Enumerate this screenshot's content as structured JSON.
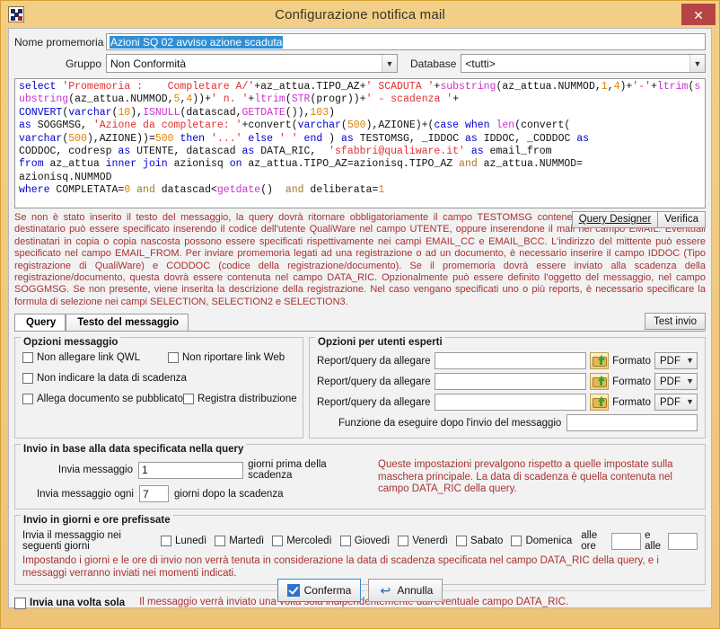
{
  "window": {
    "title": "Configurazione notifica mail",
    "close_label": "✕",
    "icon": "checkerboard-icon",
    "accent": "#eec378",
    "close_color": "#b54545"
  },
  "form": {
    "nome_label": "Nome promemoria",
    "nome_value": "Azioni SQ 02 avviso azione scaduta",
    "gruppo_label": "Gruppo",
    "gruppo_value": "Non Conformità",
    "database_label": "Database",
    "database_value": "<tutti>"
  },
  "sql": {
    "tokens": [
      {
        "t": "select ",
        "c": "k"
      },
      {
        "t": "'Promemoria :    Completare A/'",
        "c": "s"
      },
      {
        "t": "+az_attua.TIPO_AZ+",
        "c": "p"
      },
      {
        "t": "' SCADUTA '",
        "c": "s"
      },
      {
        "t": "+",
        "c": "p"
      },
      {
        "t": "substring",
        "c": "f"
      },
      {
        "t": "(az_attua.NUMMOD,",
        "c": "p"
      },
      {
        "t": "1",
        "c": "n"
      },
      {
        "t": ",",
        "c": "p"
      },
      {
        "t": "4",
        "c": "n"
      },
      {
        "t": ")+",
        "c": "p"
      },
      {
        "t": "'-'",
        "c": "s"
      },
      {
        "t": "+",
        "c": "p"
      },
      {
        "t": "ltrim",
        "c": "f"
      },
      {
        "t": "(",
        "c": "p"
      },
      {
        "t": "substring",
        "c": "f"
      },
      {
        "t": "(az_attua.NUMMOD,",
        "c": "p"
      },
      {
        "t": "5",
        "c": "n"
      },
      {
        "t": ",",
        "c": "p"
      },
      {
        "t": "4",
        "c": "n"
      },
      {
        "t": "))+",
        "c": "p"
      },
      {
        "t": "' n. '",
        "c": "s"
      },
      {
        "t": "+",
        "c": "p"
      },
      {
        "t": "ltrim",
        "c": "f"
      },
      {
        "t": "(",
        "c": "p"
      },
      {
        "t": "STR",
        "c": "f"
      },
      {
        "t": "(progr))+",
        "c": "p"
      },
      {
        "t": "' - scadenza '",
        "c": "s"
      },
      {
        "t": "+\n",
        "c": "p"
      },
      {
        "t": "CONVERT",
        "c": "k"
      },
      {
        "t": "(",
        "c": "p"
      },
      {
        "t": "varchar",
        "c": "k"
      },
      {
        "t": "(",
        "c": "p"
      },
      {
        "t": "10",
        "c": "n"
      },
      {
        "t": "),",
        "c": "p"
      },
      {
        "t": "ISNULL",
        "c": "f"
      },
      {
        "t": "(datascad,",
        "c": "p"
      },
      {
        "t": "GETDATE",
        "c": "f"
      },
      {
        "t": "()),",
        "c": "p"
      },
      {
        "t": "103",
        "c": "n"
      },
      {
        "t": ")\n",
        "c": "p"
      },
      {
        "t": "as ",
        "c": "k"
      },
      {
        "t": "SOGGMSG, ",
        "c": "p"
      },
      {
        "t": "'Azione da completare: '",
        "c": "s"
      },
      {
        "t": "+convert(",
        "c": "p"
      },
      {
        "t": "varchar",
        "c": "k"
      },
      {
        "t": "(",
        "c": "p"
      },
      {
        "t": "500",
        "c": "n"
      },
      {
        "t": "),AZIONE)+(",
        "c": "p"
      },
      {
        "t": "case when ",
        "c": "k"
      },
      {
        "t": "len",
        "c": "f"
      },
      {
        "t": "(convert(\n",
        "c": "p"
      },
      {
        "t": "varchar",
        "c": "k"
      },
      {
        "t": "(",
        "c": "p"
      },
      {
        "t": "500",
        "c": "n"
      },
      {
        "t": "),AZIONE))=",
        "c": "p"
      },
      {
        "t": "500",
        "c": "n"
      },
      {
        "t": " then ",
        "c": "k"
      },
      {
        "t": "'...'",
        "c": "s"
      },
      {
        "t": " else ",
        "c": "k"
      },
      {
        "t": "' '",
        "c": "s"
      },
      {
        "t": " end ",
        "c": "k"
      },
      {
        "t": ") ",
        "c": "p"
      },
      {
        "t": "as ",
        "c": "k"
      },
      {
        "t": "TESTOMSG, _IDDOC ",
        "c": "p"
      },
      {
        "t": "as ",
        "c": "k"
      },
      {
        "t": "IDDOC, _CODDOC ",
        "c": "p"
      },
      {
        "t": "as\n",
        "c": "k"
      },
      {
        "t": "CODDOC, codresp ",
        "c": "p"
      },
      {
        "t": "as ",
        "c": "k"
      },
      {
        "t": "UTENTE, datascad ",
        "c": "p"
      },
      {
        "t": "as ",
        "c": "k"
      },
      {
        "t": "DATA_RIC,  ",
        "c": "p"
      },
      {
        "t": "'sfabbri@qualiware.it'",
        "c": "s"
      },
      {
        "t": " as ",
        "c": "k"
      },
      {
        "t": "email_from\n",
        "c": "p"
      },
      {
        "t": "from ",
        "c": "k"
      },
      {
        "t": "az_attua ",
        "c": "p"
      },
      {
        "t": "inner join ",
        "c": "k"
      },
      {
        "t": "azionisq ",
        "c": "p"
      },
      {
        "t": "on ",
        "c": "k"
      },
      {
        "t": "az_attua.TIPO_AZ=azionisq.TIPO_AZ ",
        "c": "p"
      },
      {
        "t": "and ",
        "c": "o"
      },
      {
        "t": "az_attua.NUMMOD=\n",
        "c": "p"
      },
      {
        "t": "azionisq.NUMMOD\n",
        "c": "p"
      },
      {
        "t": "where ",
        "c": "k"
      },
      {
        "t": "COMPLETATA=",
        "c": "p"
      },
      {
        "t": "0",
        "c": "n"
      },
      {
        "t": " and ",
        "c": "o"
      },
      {
        "t": "datascad<",
        "c": "p"
      },
      {
        "t": "getdate",
        "c": "f"
      },
      {
        "t": "()  ",
        "c": "p"
      },
      {
        "t": "and ",
        "c": "o"
      },
      {
        "t": "deliberata=",
        "c": "p"
      },
      {
        "t": "1",
        "c": "n"
      }
    ]
  },
  "help": {
    "text": "Se non è stato inserito il testo del messaggio, la query dovrà ritornare obbligatoriamente il campo TESTOMSG contenente il testo del messaggio. Il destinatario può essere specificato inserendo il codice dell'utente QualiWare nel campo UTENTE, oppure inserendone il mail nel campo EMAIL. Eventuali destinatari in copia o copia nascosta possono essere specificati rispettivamente nei campi EMAIL_CC e EMAIL_BCC. L'indirizzo del mittente può essere specificato nel campo EMAIL_FROM. Per inviare promemoria legati ad una registrazione o ad un documento, è necessario inserire il campo IDDOC (Tipo registrazione di QualiWare) e CODDOC (codice della registrazione/documento). Se il promemoria dovrà essere inviato alla scadenza della registrazione/documento, questa dovrà essere contenuta nel campo DATA_RIC. Opzionalmente può essere definito l'oggetto del messaggio, nel campo SOGGMSG. Se non presente, viene inserita la descrizione della registrazione. Nel caso vengano specificati uno o più reports, è necessario specificare la formula di selezione nei campi SELECTION, SELECTION2 e SELECTION3.",
    "query_designer_label": "Query Designer",
    "verifica_label": "Verifica"
  },
  "tabs": {
    "items": [
      {
        "label": "Query",
        "active": true
      },
      {
        "label": "Testo del messaggio",
        "active": false
      }
    ],
    "test_invio_label": "Test invio"
  },
  "opzioni_messaggio": {
    "title": "Opzioni messaggio",
    "checkboxes": [
      {
        "label": "Non allegare link QWL",
        "checked": false
      },
      {
        "label": "Non riportare link Web",
        "checked": false
      },
      {
        "label": "Non indicare la data di scadenza",
        "checked": false
      },
      {
        "label": "Allega documento se pubblicato",
        "checked": false
      },
      {
        "label": "Registra distribuzione",
        "checked": false
      }
    ]
  },
  "opzioni_esperti": {
    "title": "Opzioni per utenti esperti",
    "report_label": "Report/query da allegare",
    "formato_label": "Formato",
    "rows": [
      {
        "value": "",
        "formato": "PDF"
      },
      {
        "value": "",
        "formato": "PDF"
      },
      {
        "value": "",
        "formato": "PDF"
      }
    ],
    "funzione_label": "Funzione da eseguire dopo l'invio del messaggio",
    "funzione_value": ""
  },
  "invio_data": {
    "title": "Invio in base alla data specificata nella query",
    "invia_messaggio_label": "Invia messaggio",
    "giorni_prima_value": "1",
    "giorni_prima_label": "giorni prima della scadenza",
    "invia_ogni_label": "Invia messaggio ogni",
    "giorni_dopo_value": "7",
    "giorni_dopo_label": "giorni dopo la scadenza",
    "note": "Queste impostazioni prevalgono rispetto a quelle impostate sulla maschera principale. La data di scadenza è quella contenuta nel campo DATA_RIC della query."
  },
  "invio_giorni": {
    "title": "Invio in giorni e ore prefissate",
    "prefix_label": "Invia il messaggio nei seguenti giorni",
    "days": [
      {
        "label": "Lunedì",
        "checked": false
      },
      {
        "label": "Martedì",
        "checked": false
      },
      {
        "label": "Mercoledì",
        "checked": false
      },
      {
        "label": "Giovedì",
        "checked": false
      },
      {
        "label": "Venerdì",
        "checked": false
      },
      {
        "label": "Sabato",
        "checked": false
      },
      {
        "label": "Domenica",
        "checked": false
      }
    ],
    "alle_ore_label": "alle ore",
    "alle_ore_value": "",
    "e_alle_label": "e alle",
    "e_alle_value": "",
    "note": "Impostando i giorni e le ore di invio non verrà tenuta in considerazione la data di scadenza specificata nel campo DATA_RIC della query, e i messaggi verranno inviati nei momenti indicati."
  },
  "invio_unica": {
    "checkbox_label": "Invia una volta sola",
    "checked": false,
    "note": "Il messaggio verrà inviato una volta sola indipendentemente dall'eventuale campo DATA_RIC."
  },
  "footer": {
    "conferma_label": "Conferma",
    "annulla_label": "Annulla"
  }
}
